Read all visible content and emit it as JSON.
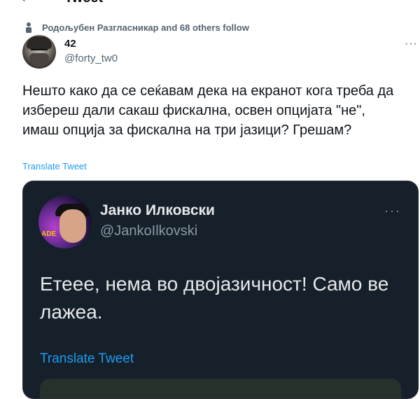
{
  "header": {
    "back_icon": "←",
    "title": "Tweet"
  },
  "social_context": {
    "icon": "person-icon",
    "text": "Родољубен Разгласникар and 68 others follow"
  },
  "tweet": {
    "author_name": "42",
    "author_handle": "@forty_tw0",
    "more_icon": "···",
    "text": "Нешто како да се сеќавам дека на екранот кога треба да избереш дали сакаш фискална, освен опцијата \"не\", имаш опција за фискална на три јазици? Грешам?",
    "translate_label": "Translate Tweet"
  },
  "quoted_tweet": {
    "author_name": "Јанко Илковски",
    "author_handle": "@JankoIlkovski",
    "more_icon": "···",
    "avatar_tag": "ADE",
    "text": "Етеее, нема во двојазичност! Само ве лажеа.",
    "translate_label": "Translate Tweet",
    "bg_color": "#15202b"
  },
  "colors": {
    "accent": "#1d9bf0",
    "text_primary": "#0f1419",
    "text_secondary": "#536471"
  }
}
